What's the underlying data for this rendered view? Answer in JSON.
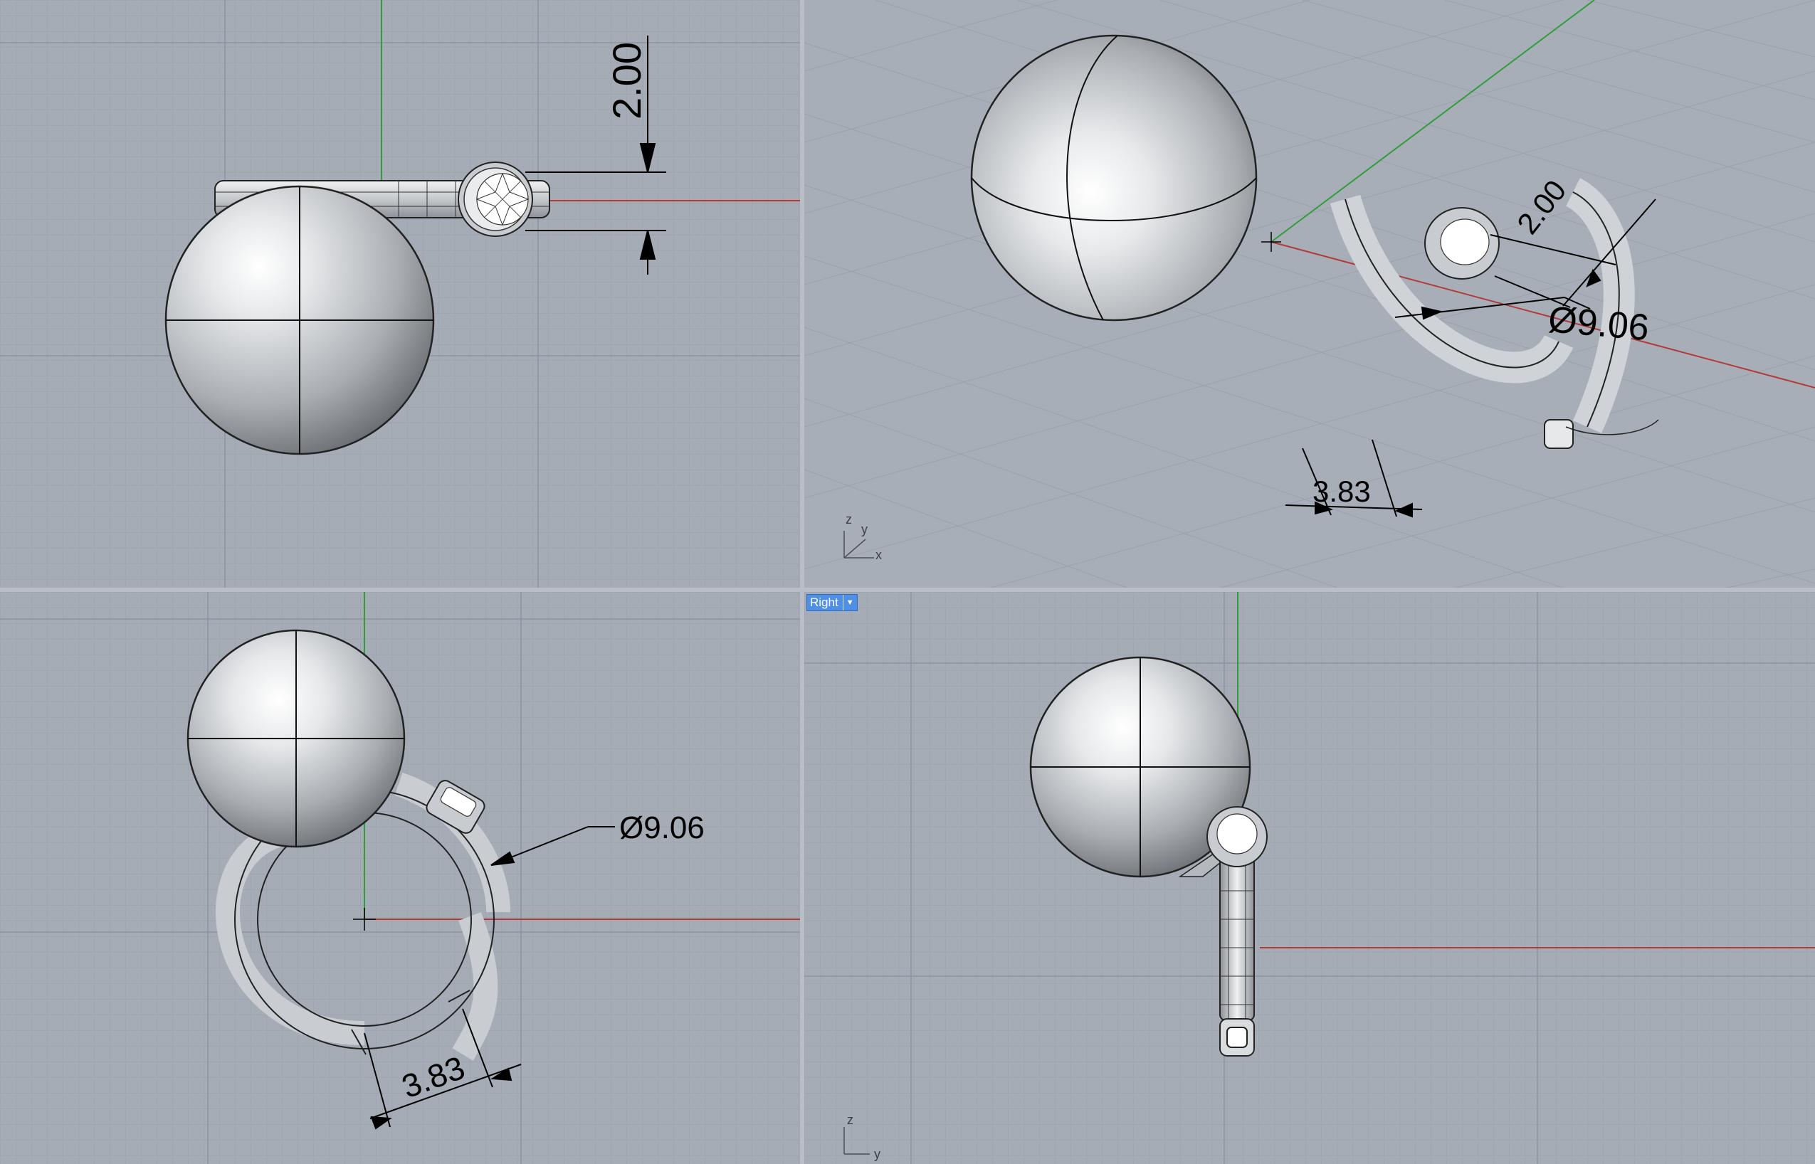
{
  "viewports": {
    "top_left": {
      "dimension_height": "2.00"
    },
    "perspective": {
      "dimension_height": "2.00",
      "dimension_diameter": "Ø9.06",
      "dimension_gap": "3.83",
      "axis_labels": {
        "z": "z",
        "y": "y",
        "x": "x"
      }
    },
    "front": {
      "dimension_diameter": "Ø9.06",
      "dimension_gap": "3.83"
    },
    "right": {
      "label": "Right",
      "dropdown_icon": "chevron-down-icon",
      "axis_labels": {
        "z": "z",
        "y": "y"
      }
    }
  },
  "colors": {
    "viewport_bg": "#a5acb6",
    "grid_minor": "#98a0ab",
    "grid_major": "#8b939f",
    "x_axis": "#b33a3a",
    "y_axis": "#2f9e3a",
    "active_label_bg": "#4f8fe6"
  }
}
